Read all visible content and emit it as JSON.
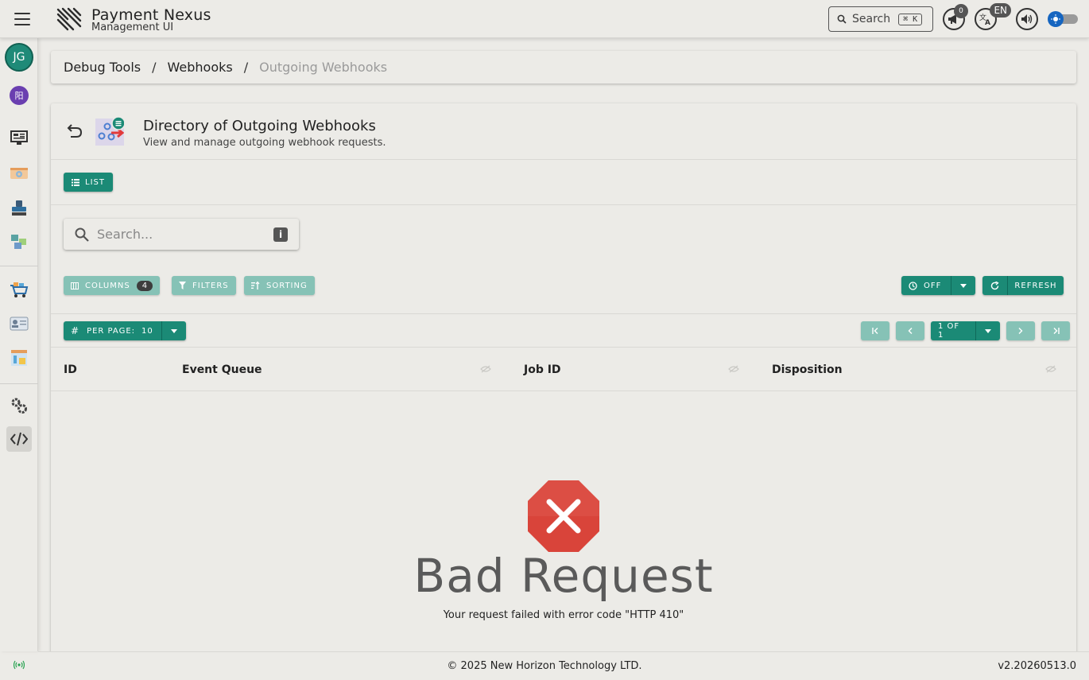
{
  "header": {
    "app_title": "Payment Nexus",
    "app_subtitle": "Management UI",
    "search_label": "Search",
    "search_shortcut": "⌘ K",
    "notification_count": "0",
    "language_code": "EN"
  },
  "sidebar": {
    "user_initials": "JG",
    "org_initial": "阳"
  },
  "breadcrumb": {
    "items": [
      "Debug Tools",
      "Webhooks",
      "Outgoing Webhooks"
    ]
  },
  "page": {
    "title": "Directory of Outgoing Webhooks",
    "subtitle": "View and manage outgoing webhook requests.",
    "view_label": "LIST"
  },
  "search": {
    "placeholder": "Search...",
    "value": ""
  },
  "toolbar": {
    "columns_label": "COLUMNS",
    "columns_count": "4",
    "filters_label": "FILTERS",
    "sorting_label": "SORTING",
    "auto_refresh_label": "OFF",
    "refresh_label": "REFRESH"
  },
  "pagination": {
    "per_page_label": "PER PAGE:",
    "per_page_value": "10",
    "page_indicator": "1 OF 1"
  },
  "table": {
    "columns": [
      "ID",
      "Event Queue",
      "Job ID",
      "Disposition"
    ]
  },
  "error": {
    "title": "Bad Request",
    "message": "Your request failed with error code \"HTTP 410\""
  },
  "footer": {
    "copyright": "© 2025 New Horizon Technology LTD.",
    "version": "v2.20260513.0"
  },
  "colors": {
    "accent": "#1b8a76",
    "accent_disabled": "#86c2b6",
    "error": "#d9443a",
    "background": "#ecebe7"
  }
}
